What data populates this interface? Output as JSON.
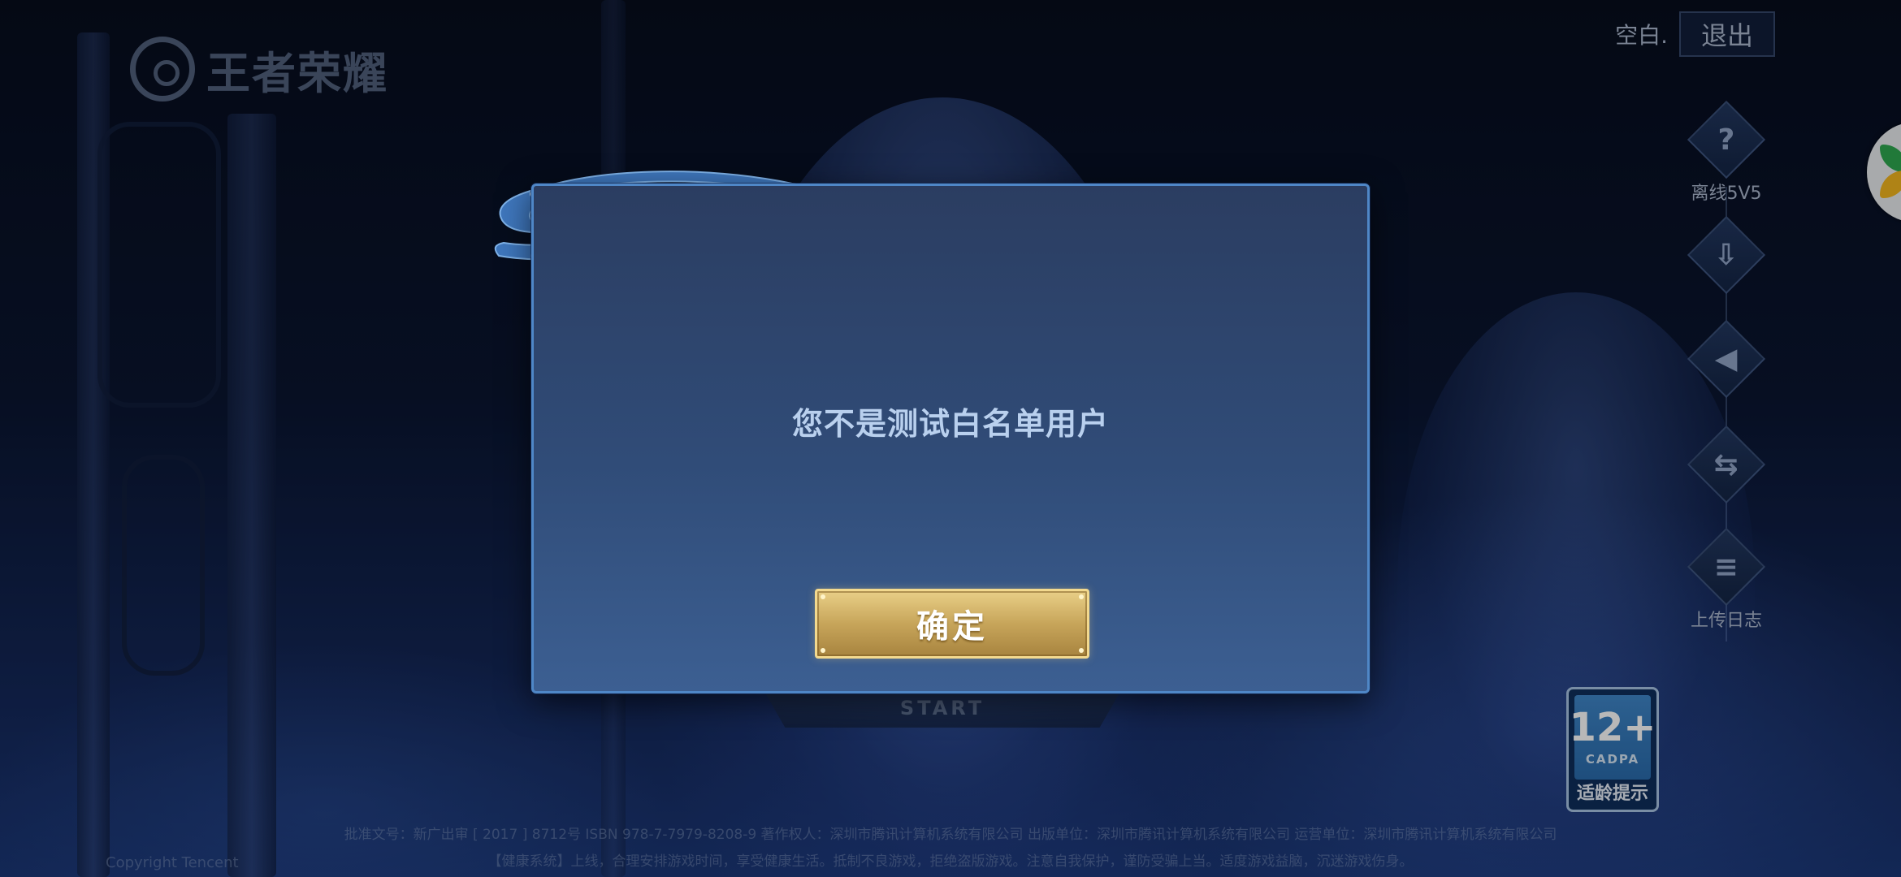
{
  "logo": {
    "text": "王者荣耀"
  },
  "header": {
    "blank_label": "空白.",
    "exit_label": "退出"
  },
  "side_menu": [
    {
      "icon": "question-icon",
      "glyph": "?",
      "label": "离线5V5"
    },
    {
      "icon": "download-icon",
      "glyph": "⇩",
      "label": ""
    },
    {
      "icon": "speaker-icon",
      "glyph": "◀",
      "label": ""
    },
    {
      "icon": "switch-account-icon",
      "glyph": "⇆",
      "label": ""
    },
    {
      "icon": "log-icon",
      "glyph": "≡",
      "label": "上传日志"
    }
  ],
  "start": {
    "label": "START"
  },
  "age_rating": {
    "number": "12+",
    "org": "CADPA",
    "tip": "适龄提示"
  },
  "footer": {
    "line1": "批准文号：新广出审 [ 2017 ] 8712号  ISBN 978-7-7979-8208-9  著作权人：深圳市腾讯计算机系统有限公司  出版单位：深圳市腾讯计算机系统有限公司  运营单位：深圳市腾讯计算机系统有限公司",
    "line2": "【健康系统】上线，合理安排游戏时间，享受健康生活。抵制不良游戏，拒绝盗版游戏。注意自我保护，谨防受骗上当。适度游戏益脑，沉迷游戏伤身。",
    "copyright": "Copyright Tencent"
  },
  "dialog": {
    "message": "您不是测试白名单用户",
    "confirm_label": "确定"
  },
  "colors": {
    "dialog_border": "#4f87c7",
    "dialog_text": "#b9d0ee",
    "button_gold": "#c7a55a",
    "button_border": "#f3d98e"
  }
}
